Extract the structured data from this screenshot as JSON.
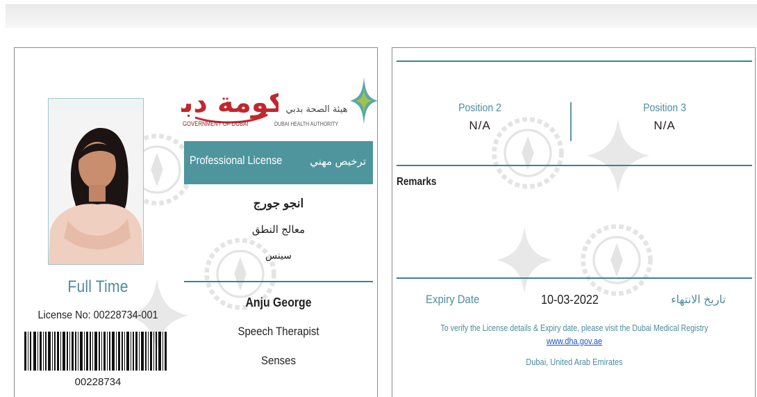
{
  "front": {
    "employment_type": "Full Time",
    "license_number_label": "License No: 00228734-001",
    "barcode_number": "00228734",
    "gov_logo_text": "GOVERNMENT OF DUBAI",
    "gov_logo_arabic": "حكومة دبي",
    "dha_logo_text": "DUBAI HEALTH AUTHORITY",
    "dha_logo_arabic": "هيئة الصحة بدبي",
    "license_title_en": "Professional License",
    "license_title_ar": "ترخيص مهني",
    "name_ar": "انجو جورج",
    "profession_ar": "معالج النطق",
    "facility_ar": "سينس",
    "name_en": "Anju George",
    "profession_en": "Speech Therapist",
    "facility_en": "Senses"
  },
  "back": {
    "position2_label": "Position 2",
    "position2_value": "N/A",
    "position3_label": "Position 3",
    "position3_value": "N/A",
    "remarks_label": "Remarks",
    "expiry_label": "Expiry Date",
    "expiry_date": "10-03-2022",
    "expiry_label_ar": "تاريخ الانتهاء",
    "verify_text": "To verify the License details & Expiry date, please visit the Dubai Medical Registry",
    "verify_link": "www.dha.gov.ae",
    "location": "Dubai, United Arab Emirates"
  },
  "colors": {
    "teal": "#4e959e",
    "label_teal": "#4b8d9c",
    "gov_red": "#c1272d",
    "link_blue": "#1a56c8"
  }
}
